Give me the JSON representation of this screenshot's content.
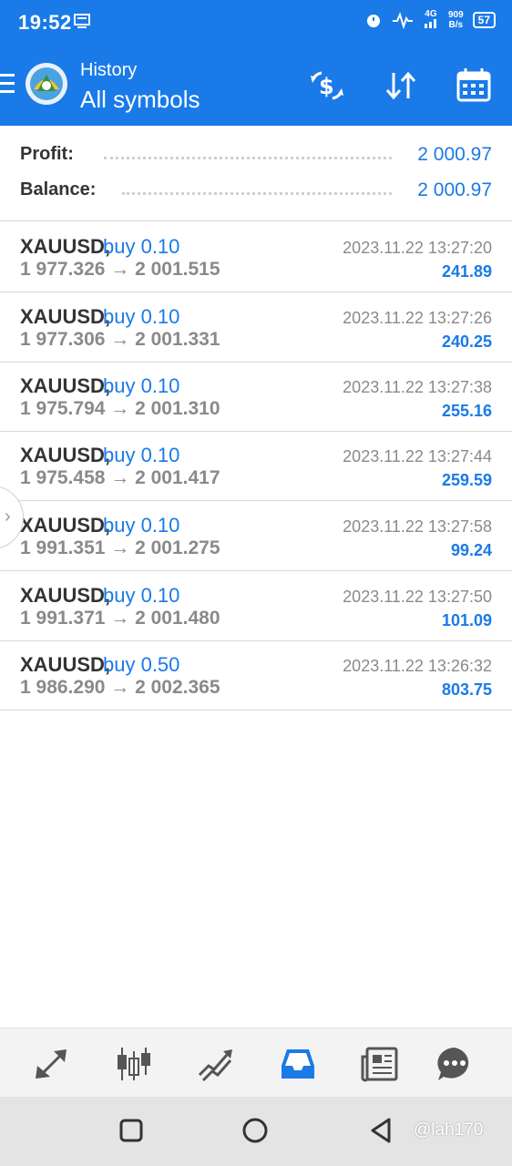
{
  "status_bar": {
    "time": "19:52",
    "network": "4G",
    "speed_value": "909",
    "speed_unit": "B/s",
    "battery": "57"
  },
  "app_bar": {
    "title_small": "History",
    "title_big": "All symbols",
    "icons": [
      "menu-icon",
      "metatrader-logo",
      "dollar-swap-icon",
      "sort-icon",
      "calendar-icon"
    ]
  },
  "summary": {
    "profit_label": "Profit:",
    "profit_value": "2 000.97",
    "balance_label": "Balance:",
    "balance_value": "2 000.97"
  },
  "trades": [
    {
      "symbol": "XAUUSD,",
      "side": "buy 0.10",
      "prices": "1 977.326 → 2 001.515",
      "time": "2023.11.22 13:27:20",
      "profit": "241.89"
    },
    {
      "symbol": "XAUUSD,",
      "side": "buy 0.10",
      "prices": "1 977.306 → 2 001.331",
      "time": "2023.11.22 13:27:26",
      "profit": "240.25"
    },
    {
      "symbol": "XAUUSD,",
      "side": "buy 0.10",
      "prices": "1 975.794 → 2 001.310",
      "time": "2023.11.22 13:27:38",
      "profit": "255.16"
    },
    {
      "symbol": "XAUUSD,",
      "side": "buy 0.10",
      "prices": "1 975.458 → 2 001.417",
      "time": "2023.11.22 13:27:44",
      "profit": "259.59"
    },
    {
      "symbol": "XAUUSD,",
      "side": "buy 0.10",
      "prices": "1 991.351 → 2 001.275",
      "time": "2023.11.22 13:27:58",
      "profit": "99.24"
    },
    {
      "symbol": "XAUUSD,",
      "side": "buy 0.10",
      "prices": "1 991.371 → 2 001.480",
      "time": "2023.11.22 13:27:50",
      "profit": "101.09"
    },
    {
      "symbol": "XAUUSD,",
      "side": "buy 0.50",
      "prices": "1 986.290 → 2 002.365",
      "time": "2023.11.22 13:26:32",
      "profit": "803.75"
    }
  ],
  "tabs": [
    "quotes",
    "chart",
    "trade",
    "history",
    "news",
    "messages"
  ],
  "watermark": "@lah170",
  "colors": {
    "accent": "#1a7ae8",
    "muted": "#8a8a8a",
    "text": "#333333"
  }
}
